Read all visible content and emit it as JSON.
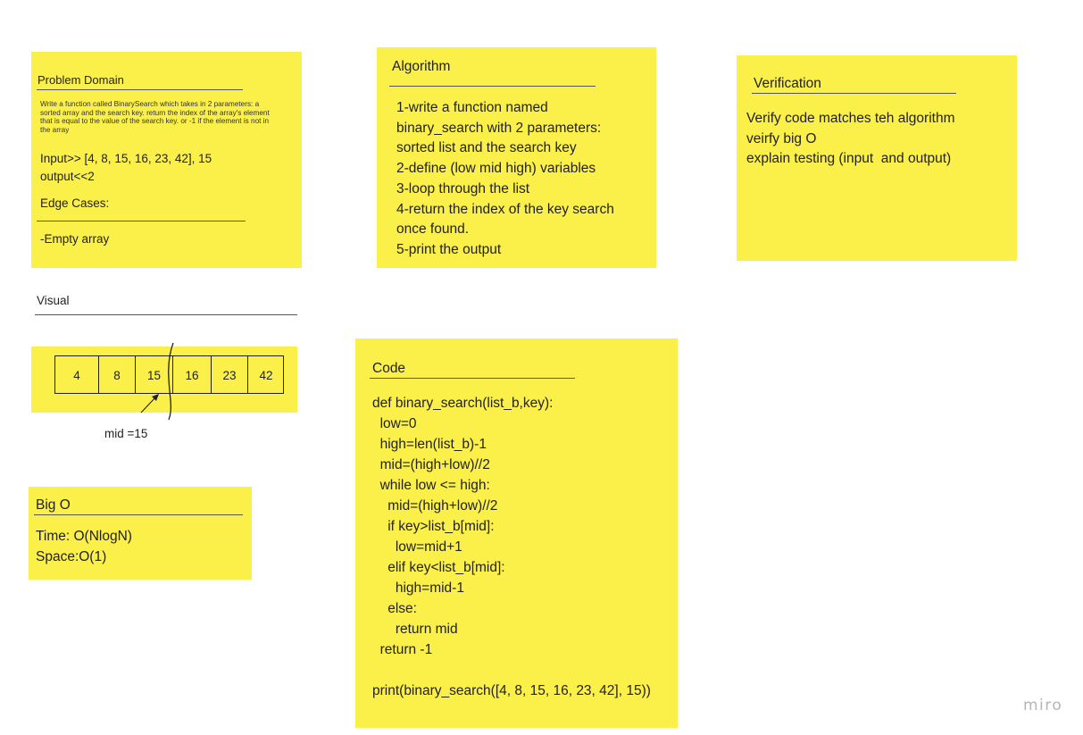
{
  "board": {
    "watermark": "miro"
  },
  "problem_domain": {
    "title": "Problem Domain",
    "description": "Write a function called BinarySearch which takes in 2 parameters: a sorted array and the search key. return the index of the array's element that is equal to the value of the search key. or -1 if the element is not in the array",
    "input_output": "Input>> [4, 8, 15, 16, 23, 42], 15\noutput<<2",
    "edge_cases_title": "Edge Cases:",
    "edge_cases": "-Empty array"
  },
  "algorithm": {
    "title": "Algorithm",
    "steps": "1-write a function named\nbinary_search with 2 parameters:\nsorted list and the search key\n2-define (low mid high) variables\n3-loop through the list\n4-return the index of the key search\nonce found.\n5-print the output"
  },
  "verification": {
    "title": "Verification",
    "items": "Verify code matches teh algorithm\nveirfy big O\nexplain testing (input  and output)"
  },
  "visual": {
    "title": "Visual",
    "cells": [
      "4",
      "8",
      "15",
      "16",
      "23",
      "42"
    ],
    "mid_label": "mid =15"
  },
  "big_o": {
    "title": "Big O",
    "text": "Time: O(NlogN)\nSpace:O(1)"
  },
  "code": {
    "title": "Code",
    "source": "def binary_search(list_b,key):\n  low=0\n  high=len(list_b)-1\n  mid=(high+low)//2\n  while low <= high:\n    mid=(high+low)//2\n    if key>list_b[mid]:\n      low=mid+1\n    elif key<list_b[mid]:\n      high=mid-1\n    else:\n      return mid\n  return -1\n\nprint(binary_search([4, 8, 15, 16, 23, 42], 15))"
  },
  "colors": {
    "sticky": "#fbf04a",
    "ink": "#222222",
    "watermark": "#b5b5b5"
  }
}
